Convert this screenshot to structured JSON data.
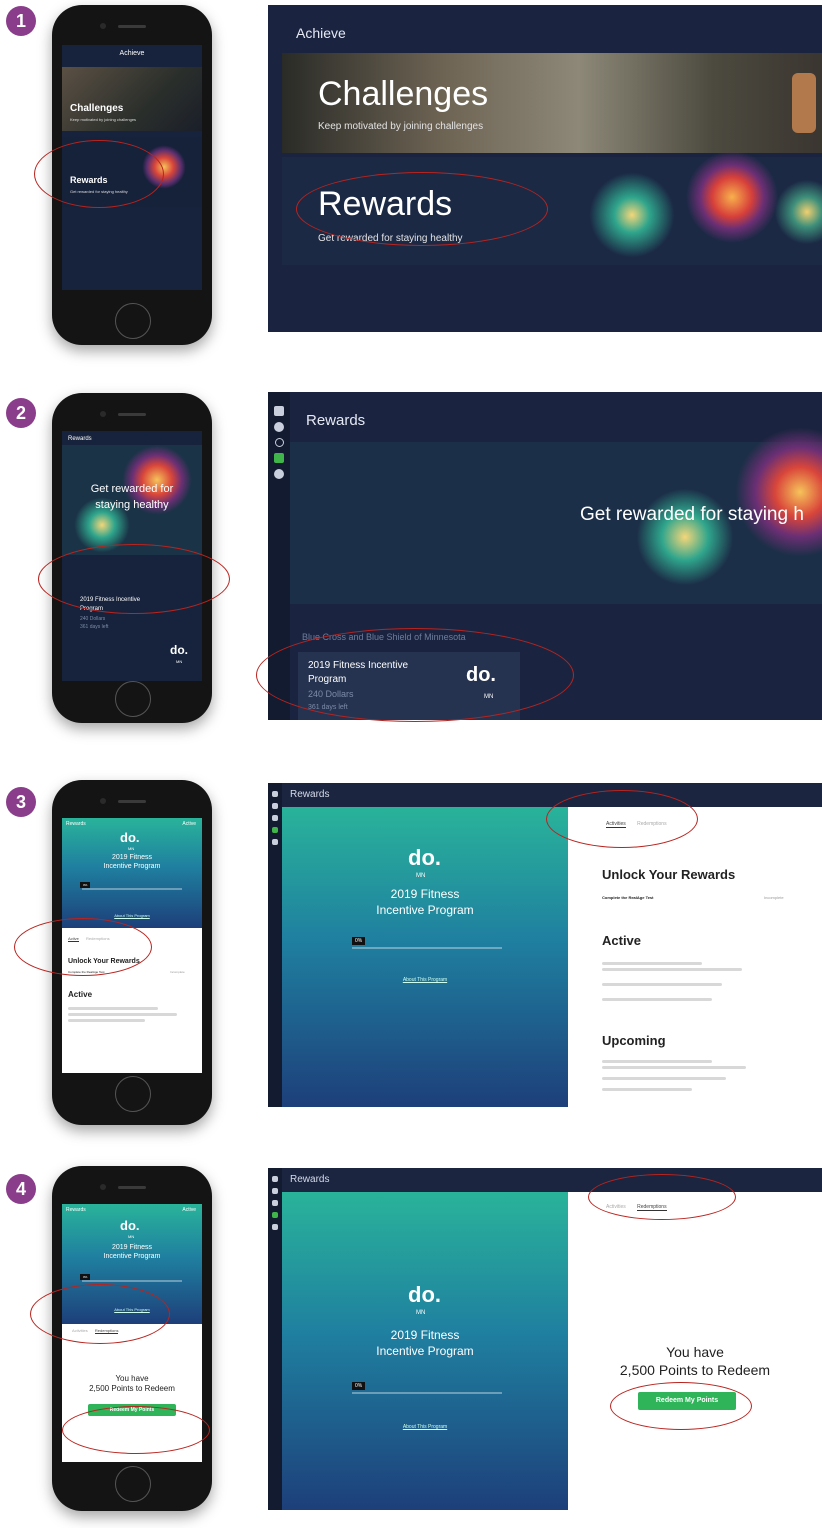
{
  "steps": [
    "1",
    "2",
    "3",
    "4"
  ],
  "step1": {
    "phone": {
      "header": "Achieve",
      "card1_title": "Challenges",
      "card1_sub": "Keep motivated by joining challenges",
      "card2_title": "Rewards",
      "card2_sub": "Get rewarded for staying healthy"
    },
    "panel": {
      "header": "Achieve",
      "card1_title": "Challenges",
      "card1_sub": "Keep motivated by joining challenges",
      "card2_title": "Rewards",
      "card2_sub": "Get rewarded for staying healthy"
    }
  },
  "step2": {
    "phone": {
      "header": "Rewards",
      "hero": "Get rewarded for staying healthy",
      "program_line1": "2019 Fitness Incentive",
      "program_line2": "Program",
      "amount": "240 Dollars",
      "days": "361 days left",
      "logo": "do.",
      "logo_sub": "MN"
    },
    "panel": {
      "header": "Rewards",
      "hero": "Get rewarded for staying h",
      "org": "Blue Cross and Blue Shield of Minnesota",
      "program_line1": "2019 Fitness Incentive",
      "program_line2": "Program",
      "amount": "240 Dollars",
      "days": "361 days left",
      "logo": "do.",
      "logo_sub": "MN"
    }
  },
  "step3": {
    "phone": {
      "header": "Rewards",
      "status": "Active",
      "logo": "do.",
      "logo_sub": "MN",
      "program_line1": "2019 Fitness",
      "program_line2": "Incentive Program",
      "progress_tag": "0%",
      "about": "About This Program",
      "tab_active": "Active",
      "tab_other": "Redemptions",
      "unlock": "Unlock Your Rewards",
      "task": "Complete the RealAge Test",
      "task_status": "Incomplete",
      "active_heading": "Active"
    },
    "panel": {
      "header": "Rewards",
      "logo": "do.",
      "logo_sub": "MN",
      "program_line1": "2019 Fitness",
      "program_line2": "Incentive Program",
      "progress_tag": "0%",
      "about": "About This Program",
      "tab_active": "Activities",
      "tab_other": "Redemptions",
      "unlock": "Unlock Your Rewards",
      "task": "Complete the RealAge Test",
      "task_status": "Incomplete",
      "active_heading": "Active",
      "upcoming_heading": "Upcoming"
    }
  },
  "step4": {
    "phone": {
      "header": "Rewards",
      "status": "Active",
      "logo": "do.",
      "logo_sub": "MN",
      "program_line1": "2019 Fitness",
      "program_line2": "Incentive Program",
      "progress_tag": "0%",
      "about": "About This Program",
      "tab_other": "Activities",
      "tab_active": "Redemptions",
      "you_have": "You have",
      "points": "2,500 Points to Redeem",
      "button": "Redeem My Points"
    },
    "panel": {
      "header": "Rewards",
      "logo": "do.",
      "logo_sub": "MN",
      "program_line1": "2019 Fitness",
      "program_line2": "Incentive Program",
      "progress_tag": "0%",
      "about": "About This Program",
      "tab_other": "Activities",
      "tab_active": "Redemptions",
      "you_have": "You have",
      "points": "2,500 Points to Redeem",
      "button": "Redeem My Points"
    }
  },
  "colors": {
    "badge": "#8a3d8a",
    "navy": "#1a2440",
    "highlight": "#b8241f",
    "green": "#2fb45a",
    "teal": "#29b39a"
  }
}
